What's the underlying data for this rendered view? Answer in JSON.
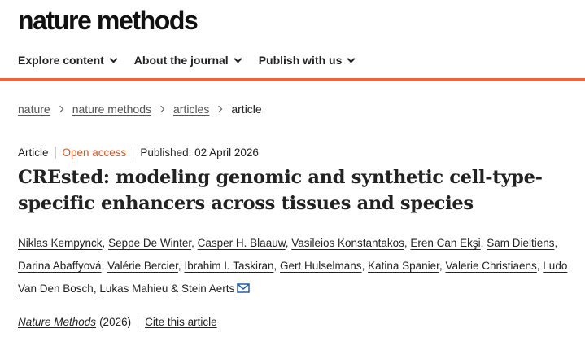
{
  "brand": {
    "logo": "nature methods"
  },
  "nav": {
    "items": [
      {
        "label": "Explore content"
      },
      {
        "label": "About the journal"
      },
      {
        "label": "Publish with us"
      }
    ]
  },
  "breadcrumb": {
    "links": [
      "nature",
      "nature methods",
      "articles"
    ],
    "current": "article"
  },
  "article": {
    "type": "Article",
    "access": "Open access",
    "published": "Published: 02 April 2026",
    "title": "CREsted: modeling genomic and synthetic cell-type-specific enhancers across tissues and species",
    "authors": [
      "Niklas Kempynck",
      "Seppe De Winter",
      "Casper H. Blaauw",
      "Vasileios Konstantakos",
      "Eren Can Ekşi",
      "Sam Dieltiens",
      "Darina Abaffyová",
      "Valérie Bercier",
      "Ibrahim I. Taskiran",
      "Gert Hulselmans",
      "Katina Spanier",
      "Valerie Christiaens",
      "Ludo Van Den Bosch",
      "Lukas Mahieu",
      "Stein Aerts"
    ],
    "author_sep": ",",
    "author_and": "&",
    "journal": "Nature Methods",
    "year": "(2026)",
    "cite_label": "Cite this article"
  },
  "colors": {
    "accent": "#e8663a",
    "open_access": "#d4541c"
  },
  "icons": {
    "nav_dropdown": "chevron-down-icon",
    "breadcrumb_sep": "chevron-right-icon",
    "contact": "mail-icon"
  }
}
